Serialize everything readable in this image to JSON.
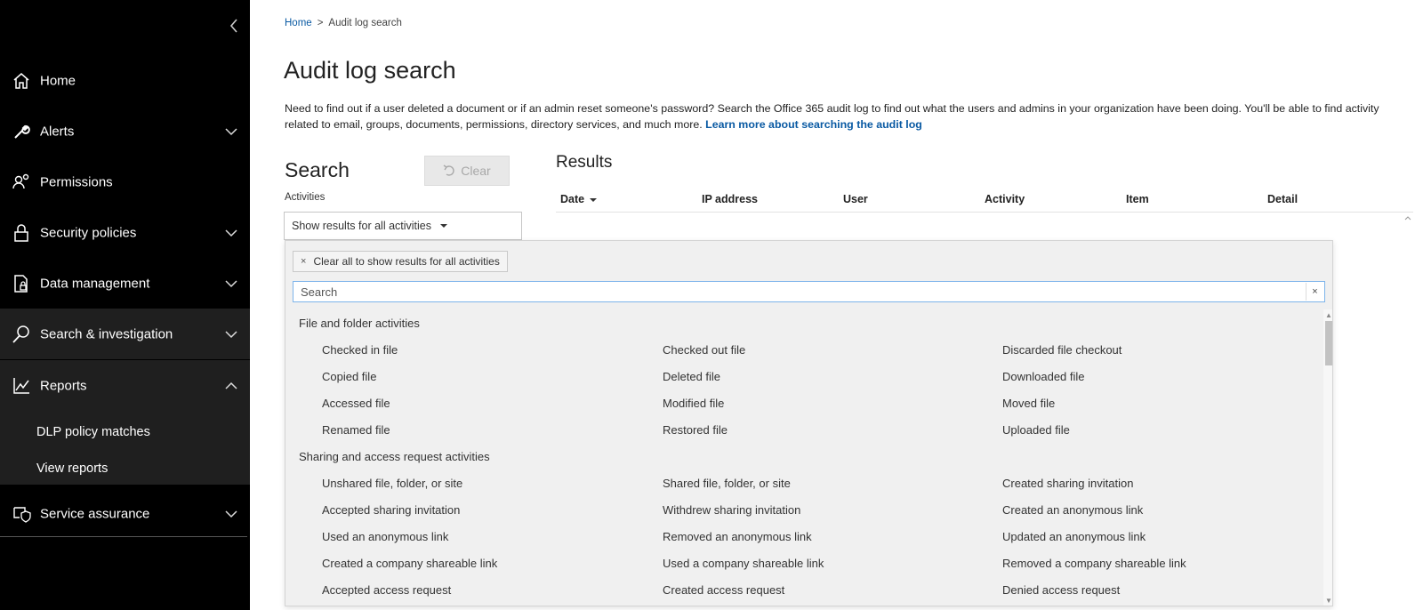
{
  "sidebar": {
    "items": [
      {
        "label": "Home",
        "icon": "home-icon",
        "chevron": false
      },
      {
        "label": "Alerts",
        "icon": "wrench-icon",
        "chevron": "down"
      },
      {
        "label": "Permissions",
        "icon": "people-icon",
        "chevron": false
      },
      {
        "label": "Security policies",
        "icon": "lock-icon",
        "chevron": "down"
      },
      {
        "label": "Data management",
        "icon": "document-lock-icon",
        "chevron": "down"
      },
      {
        "label": "Search & investigation",
        "icon": "search-icon",
        "chevron": "down"
      },
      {
        "label": "Reports",
        "icon": "chart-icon",
        "chevron": "up"
      },
      {
        "label": "Service assurance",
        "icon": "shield-check-icon",
        "chevron": "down"
      }
    ],
    "subitems": [
      "DLP policy matches",
      "View reports"
    ]
  },
  "breadcrumb": {
    "home": "Home",
    "separator": ">",
    "current": "Audit log search"
  },
  "page_title": "Audit log search",
  "description": {
    "line1": "Need to find out if a user deleted a document or if an admin reset someone's password? Search the Office 365 audit log to find out what the users and admins in your organization have been doing. You'll be able to find activity",
    "line2": "related to email, groups, documents, permissions, directory services, and much more.",
    "link": "Learn more about searching the audit log"
  },
  "search": {
    "heading": "Search",
    "clear_label": "Clear",
    "activities_label": "Activities",
    "activities_value": "Show results for all activities"
  },
  "results": {
    "heading": "Results",
    "columns": [
      "Date",
      "IP address",
      "User",
      "Activity",
      "Item",
      "Detail"
    ]
  },
  "dropdown": {
    "chip_label": "Clear all to show results for all activities",
    "chip_x": "×",
    "search_placeholder": "Search",
    "search_clear": "×",
    "groups": [
      {
        "title": "File and folder activities",
        "rows": [
          [
            "Checked in file",
            "Checked out file",
            "Discarded file checkout"
          ],
          [
            "Copied file",
            "Deleted file",
            "Downloaded file"
          ],
          [
            "Accessed file",
            "Modified file",
            "Moved file"
          ],
          [
            "Renamed file",
            "Restored file",
            "Uploaded file"
          ]
        ]
      },
      {
        "title": "Sharing and access request activities",
        "rows": [
          [
            "Unshared file, folder, or site",
            "Shared file, folder, or site",
            "Created sharing invitation"
          ],
          [
            "Accepted sharing invitation",
            "Withdrew sharing invitation",
            "Created an anonymous link"
          ],
          [
            "Used an anonymous link",
            "Removed an anonymous link",
            "Updated an anonymous link"
          ],
          [
            "Created a company shareable link",
            "Used a company shareable link",
            "Removed a company shareable link"
          ],
          [
            "Accepted access request",
            "Created access request",
            "Denied access request"
          ]
        ]
      }
    ]
  }
}
